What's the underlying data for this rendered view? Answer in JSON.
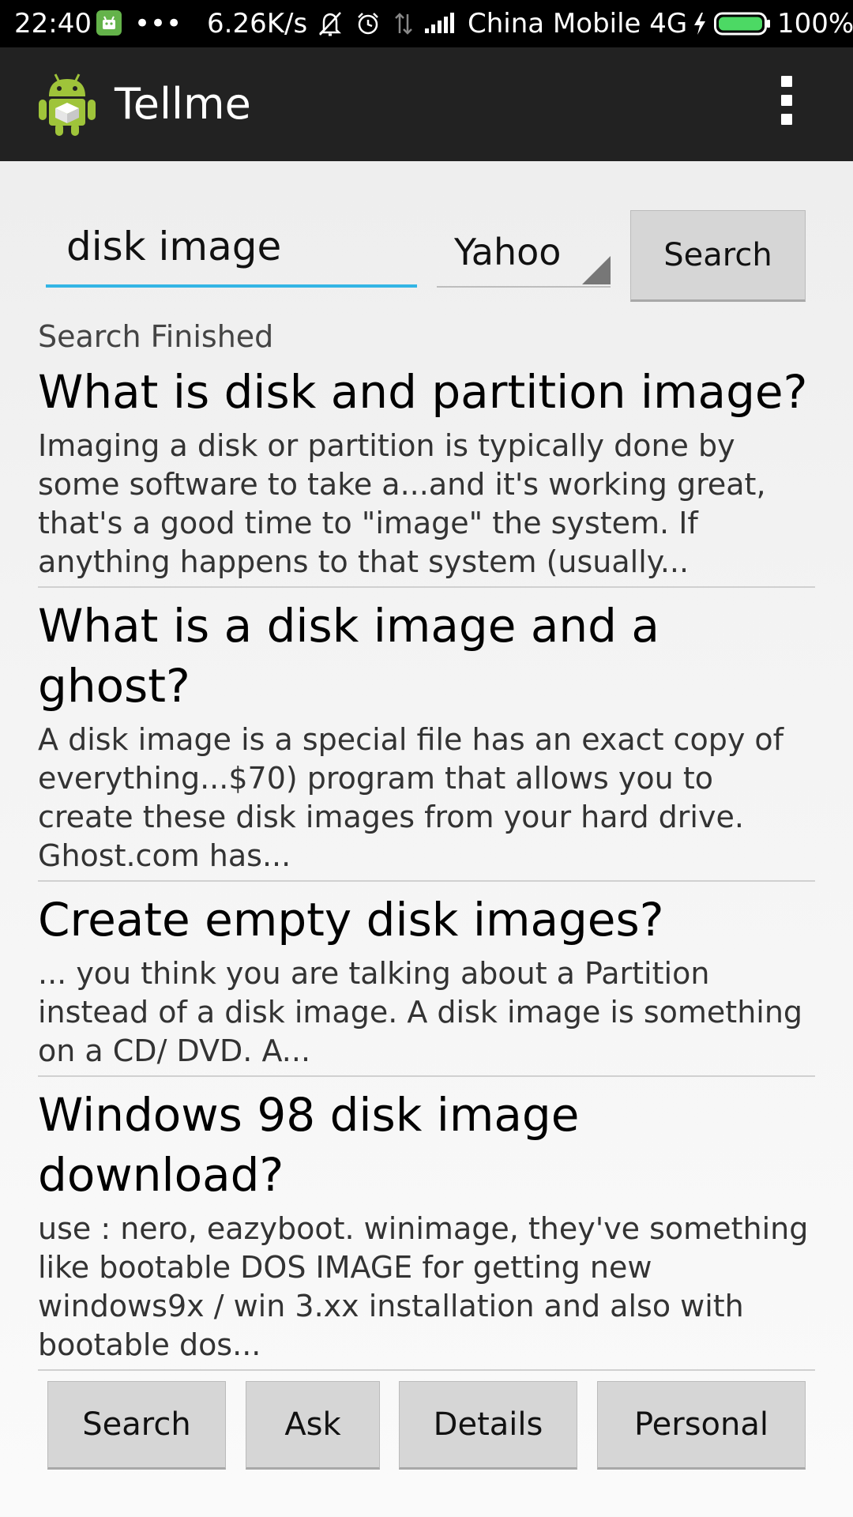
{
  "status_bar": {
    "time": "22:40",
    "dots": "•••",
    "net_speed": "6.26K/s",
    "carrier": "China Mobile 4G",
    "battery_percent": "100%",
    "icons": [
      "notification-app-icon",
      "mute-icon",
      "alarm-icon",
      "data-arrows-icon",
      "signal-icon",
      "charging-bolt-icon",
      "battery-icon"
    ]
  },
  "action_bar": {
    "title": "Tellme",
    "overflow_icon": "overflow-menu-icon"
  },
  "search": {
    "query": "disk image",
    "engine": "Yahoo",
    "button_label": "Search"
  },
  "status_text": "Search Finished",
  "results": [
    {
      "title": "What is disk and partition image?",
      "snippet": "Imaging a disk or partition is typically done by some software to take a...and it's working great, that's a good time to \"image\" the system. If anything happens to that system (usually..."
    },
    {
      "title": "What is a disk image and a ghost?",
      "snippet": "A disk image is a special file has an exact copy of everything...$70) program that allows you to create these disk images from your hard drive. Ghost.com has..."
    },
    {
      "title": "Create empty disk images?",
      "snippet": "... you think you are talking about a Partition instead of a disk image. A disk image is something on a CD/ DVD. A..."
    },
    {
      "title": "Windows 98 disk image download?",
      "snippet": "use : nero, eazyboot. winimage, they've something like bootable DOS IMAGE for getting new windows9x / win 3.xx installation and also with bootable dos..."
    }
  ],
  "bottom_nav": {
    "search": "Search",
    "ask": "Ask",
    "details": "Details",
    "personal": "Personal"
  },
  "colors": {
    "input_underline": "#33b5e5",
    "action_bar": "#222222",
    "android_green": "#9fc43a"
  }
}
